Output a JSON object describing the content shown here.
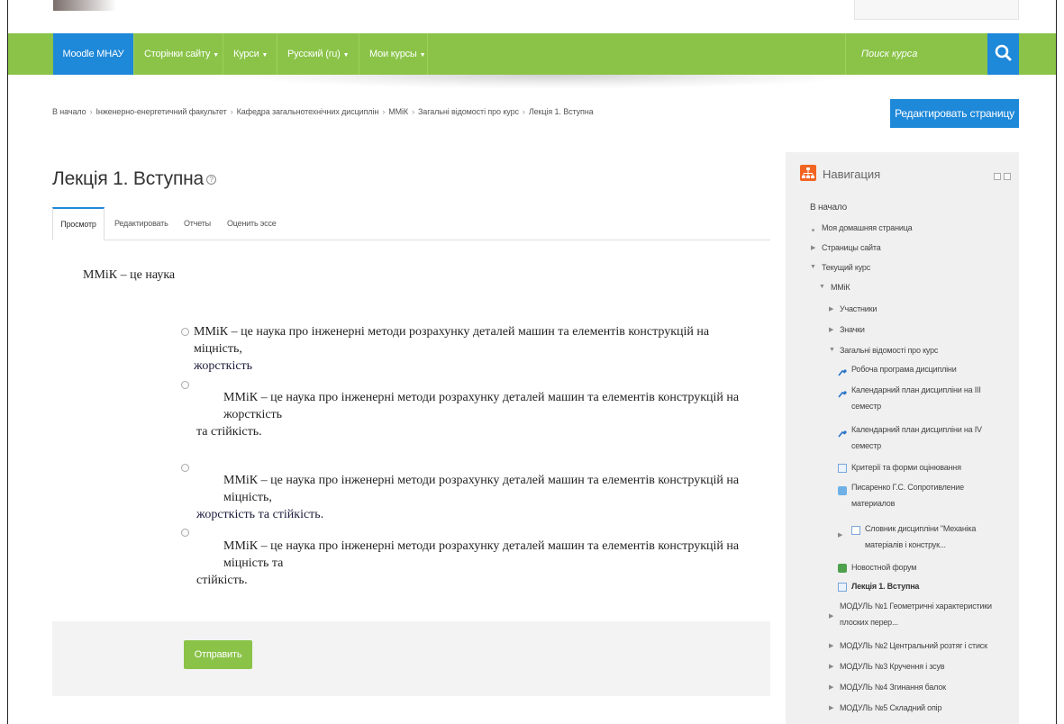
{
  "navbar": {
    "home": "Moodle МНАУ",
    "items": [
      "Сторінки сайту",
      "Курси",
      "Русский (ru)",
      "Мои курсы"
    ],
    "search_placeholder": "Поиск курса"
  },
  "breadcrumb": [
    "В начало",
    "Інженерно-енергетичний факультет",
    "Кафедра загальнотехнічних дисциплін",
    "ММіК",
    "Загальні відомості про курс",
    "Лекція 1. Вступна"
  ],
  "edit_page_button": "Редактировать страницу",
  "page_title": "Лекція 1. Вступна",
  "tabs": [
    "Просмотр",
    "Редактировать",
    "Отчеты",
    "Оценить эссе"
  ],
  "question": {
    "text": "ММіК – це наука",
    "answers": [
      {
        "lines": [
          "ММіК – це наука про інженерні методи розрахунку деталей машин та елементів конструкцій на міцність,",
          "жорсткість"
        ]
      },
      {
        "lines": [
          "ММіК – це наука про інженерні методи розрахунку деталей машин та елементів конструкцій на жорсткість",
          "та стійкість."
        ]
      },
      {
        "lines": [
          "ММіК – це наука про інженерні методи розрахунку деталей машин та елементів конструкцій на міцність,",
          "жорсткість та стійкість."
        ]
      },
      {
        "lines": [
          "ММіК – це наука про інженерні методи розрахунку деталей машин та елементів конструкцій на міцність та",
          "стійкість."
        ]
      }
    ]
  },
  "submit_button": "Отправить",
  "sidebar": {
    "title": "Навигация",
    "home": "В начало",
    "my_home": "Моя домашняя страница",
    "site_pages": "Страницы сайта",
    "current_course": "Текущий курс",
    "course": "ММіК",
    "participants": "Участники",
    "badges": "Значки",
    "section_general": "Загальні відомості про курс",
    "resources": [
      "Робоча програма дисципліни",
      "Календарний план дисципліни на ІІІ семестр",
      "Календарний план дисципліни на IV семестр",
      "Критерії та форми оцінювання",
      "Писаренко Г.С. Сопротивление материалов",
      "Словник дисципліни \"Механіка матеріалів і конструк...",
      "Новостной форум",
      "Лекція 1. Вступна"
    ],
    "modules": [
      "МОДУЛЬ №1 Геометричні характеристики плоских перер...",
      "МОДУЛЬ №2 Центральний розтяг і стиск",
      "МОДУЛЬ №3 Кручення і зсув",
      "МОДУЛЬ №4 Згинання балок",
      "МОДУЛЬ №5 Складний опір"
    ]
  },
  "colors": {
    "navbar_green": "#8ac348",
    "accent_blue": "#1e88d9",
    "nav_icon_orange": "#f26522"
  }
}
